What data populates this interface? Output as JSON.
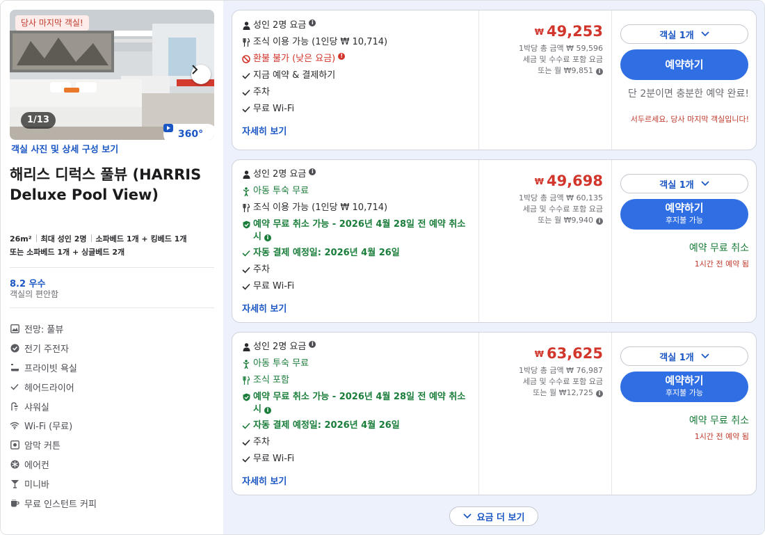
{
  "room": {
    "badge": "당사 마지막 객실!",
    "photo_counter": "1/13",
    "view360_label": "360°",
    "photo_link": "객실 사진 및 상세 구성 보기",
    "title": "해리스 디럭스 풀뷰 (HARRIS Deluxe Pool View)",
    "size": "26m²",
    "occupancy": "최대 성인 2명",
    "beds_line1": "소파베드 1개 + 킹베드 1개",
    "beds_line2": "또는 소파베드 1개 + 싱글베드 2개",
    "score": "8.2 우수",
    "score_label": "객실의 편안함",
    "amenities": [
      {
        "label": "전망: 풀뷰",
        "icon": "view-icon"
      },
      {
        "label": "전기 주전자",
        "icon": "kettle-icon"
      },
      {
        "label": "프라이빗 욕실",
        "icon": "bathtub-icon"
      },
      {
        "label": "헤어드라이어",
        "icon": "check-icon"
      },
      {
        "label": "샤워실",
        "icon": "shower-icon"
      },
      {
        "label": "Wi-Fi (무료)",
        "icon": "wifi-icon"
      },
      {
        "label": "암막 커튼",
        "icon": "curtain-icon"
      },
      {
        "label": "에어컨",
        "icon": "aircon-icon"
      },
      {
        "label": "미니바",
        "icon": "minibar-icon"
      },
      {
        "label": "무료 인스턴트 커피",
        "icon": "coffee-icon"
      }
    ]
  },
  "rates": [
    {
      "occupancy": "성인 2명 요금",
      "breakfast": "조식 이용 가능 (1인당 ₩ 10,714)",
      "refund": "환불 불가 (낮은 요금)",
      "pay_now": "지금 예약 & 결제하기",
      "parking": "주차",
      "wifi": "무료 Wi-Fi",
      "details": "자세히 보기",
      "currency": "₩",
      "price": "49,253",
      "total": "1박당 총 금액 ₩ 59,596",
      "tax_note": "세금 및 수수료 포함 요금",
      "monthly": "또는 월 ₩9,851",
      "room_select": "객실 1개",
      "reserve": "예약하기",
      "quick_msg": "단 2분이면 충분한 예약 완료!",
      "hurry": "서두르세요, 당사 마지막 객실입니다!"
    },
    {
      "occupancy": "성인 2명 요금",
      "kids": "아동 투숙 무료",
      "breakfast": "조식 이용 가능 (1인당 ₩ 10,714)",
      "free_cancel": "예약 무료 취소 가능 - 2026년 4월 28일 전 예약 취소 시",
      "autopay": "자동 결제 예정일: 2026년 4월 26일",
      "parking": "주차",
      "wifi": "무료 Wi-Fi",
      "details": "자세히 보기",
      "currency": "₩",
      "price": "49,698",
      "total": "1박당 총 금액 ₩ 60,135",
      "tax_note": "세금 및 수수료 포함 요금",
      "monthly": "또는 월 ₩9,940",
      "room_select": "객실 1개",
      "reserve": "예약하기",
      "reserve_sub": "후지불 가능",
      "cancel_badge": "예약 무료 취소",
      "cancel_note": "1시간 전 예약 됨"
    },
    {
      "occupancy": "성인 2명 요금",
      "kids": "아동 투숙 무료",
      "breakfast": "조식 포함",
      "free_cancel": "예약 무료 취소 가능 - 2026년 4월 28일 전 예약 취소 시",
      "autopay": "자동 결제 예정일: 2026년 4월 26일",
      "parking": "주차",
      "wifi": "무료 Wi-Fi",
      "details": "자세히 보기",
      "currency": "₩",
      "price": "63,625",
      "total": "1박당 총 금액 ₩ 76,987",
      "tax_note": "세금 및 수수료 포함 요금",
      "monthly": "또는 월 ₩12,725",
      "room_select": "객실 1개",
      "reserve": "예약하기",
      "reserve_sub": "후지불 가능",
      "cancel_badge": "예약 무료 취소",
      "cancel_note": "1시간 전 예약 됨"
    }
  ],
  "more_rates": "요금 더 보기",
  "colors": {
    "accent": "#2f6ee3",
    "link": "#1a56c4",
    "price": "#d2352b",
    "success": "#1a7d3a",
    "panel_bg": "#edf1fb"
  }
}
